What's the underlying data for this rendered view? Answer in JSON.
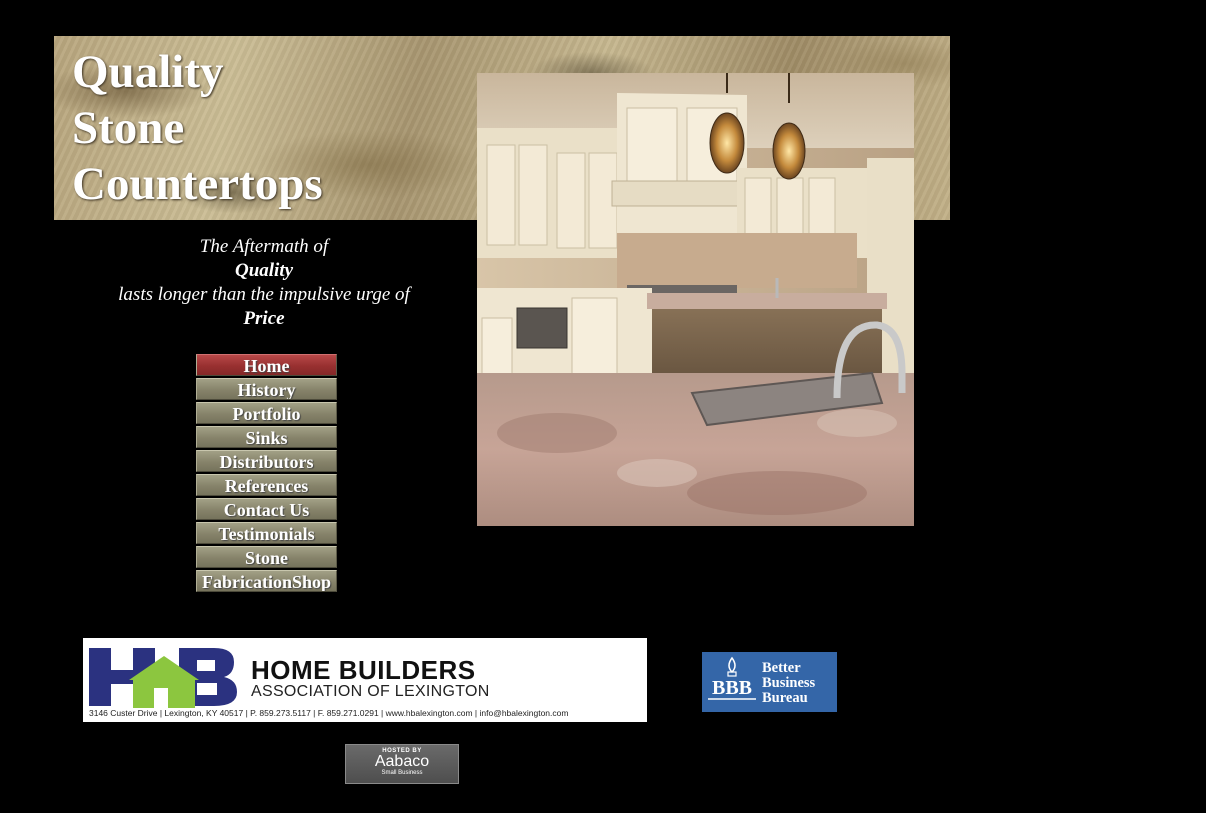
{
  "header": {
    "title_lines": [
      "Quality",
      "Stone",
      "Countertops"
    ]
  },
  "tagline": {
    "line1": "The Aftermath of",
    "line2": "Quality",
    "line3": "lasts longer than the impulsive urge of",
    "line4": "Price"
  },
  "nav": {
    "items": [
      {
        "label": "Home",
        "active": true
      },
      {
        "label": "History"
      },
      {
        "label": "Portfolio"
      },
      {
        "label": "Sinks"
      },
      {
        "label": "Distributors"
      },
      {
        "label": "References"
      },
      {
        "label": "Contact Us"
      },
      {
        "label": "Testimonials"
      },
      {
        "label": "Stone"
      },
      {
        "label": "FabricationShop"
      }
    ]
  },
  "hba_logo": {
    "name": "HOME BUILDERS",
    "subtitle": "ASSOCIATION OF LEXINGTON",
    "address": "3146 Custer Drive | Lexington, KY 40517 | P. 859.273.5117 | F. 859.271.0291 | www.hbalexington.com | info@hbalexington.com"
  },
  "bbb_logo": {
    "mark": "BBB",
    "line1": "Better",
    "line2": "Business",
    "line3": "Bureau"
  },
  "aabaco_badge": {
    "hosted": "HOSTED BY",
    "name": "Aabaco",
    "sub": "Small Business"
  },
  "colors": {
    "background": "#000000",
    "nav_active": "#983030",
    "nav_default": "#86836a",
    "bbb_blue": "#3466a8",
    "hba_green": "#8cc63f",
    "hba_navy": "#2b3280"
  }
}
